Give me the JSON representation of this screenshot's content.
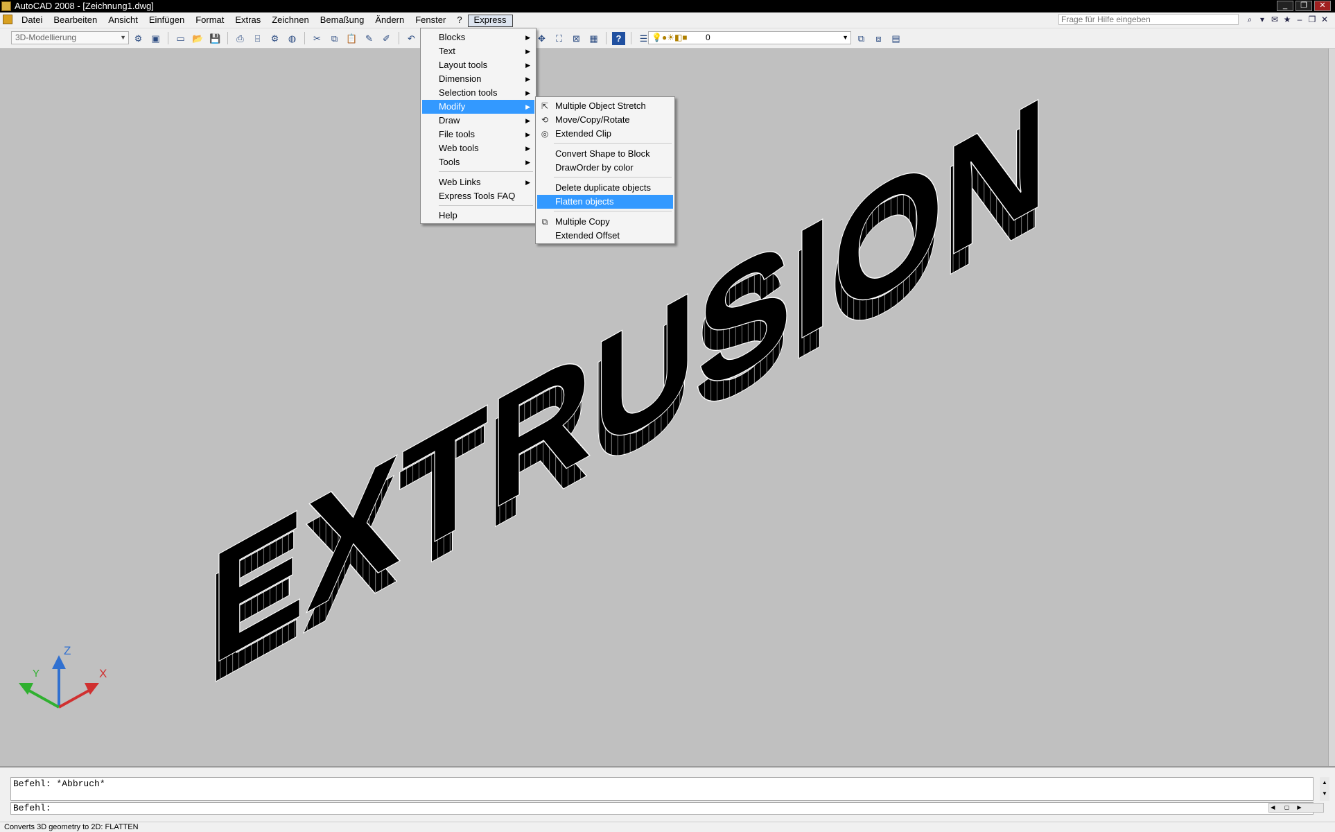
{
  "window": {
    "title": "AutoCAD 2008 - [Zeichnung1.dwg]",
    "controls": [
      "_",
      "❐",
      "✕"
    ]
  },
  "menubar": {
    "items": [
      "Datei",
      "Bearbeiten",
      "Ansicht",
      "Einfügen",
      "Format",
      "Extras",
      "Zeichnen",
      "Bemaßung",
      "Ändern",
      "Fenster",
      "?",
      "Express"
    ],
    "active": "Express",
    "help_placeholder": "Frage für Hilfe eingeben"
  },
  "toolbar": {
    "workspace": "3D-Modellierung",
    "layer_name": "0"
  },
  "express_menu": {
    "items": [
      {
        "label": "Blocks",
        "submenu": true
      },
      {
        "label": "Text",
        "submenu": true
      },
      {
        "label": "Layout tools",
        "submenu": true
      },
      {
        "label": "Dimension",
        "submenu": true
      },
      {
        "label": "Selection tools",
        "submenu": true
      },
      {
        "label": "Modify",
        "submenu": true,
        "highlighted": true
      },
      {
        "label": "Draw",
        "submenu": true
      },
      {
        "label": "File tools",
        "submenu": true
      },
      {
        "label": "Web tools",
        "submenu": true
      },
      {
        "label": "Tools",
        "submenu": true
      },
      {
        "label": "Web Links",
        "submenu": true
      },
      {
        "label": "Express Tools FAQ",
        "submenu": false
      },
      {
        "label": "Help",
        "submenu": false
      }
    ]
  },
  "modify_submenu": {
    "items": [
      {
        "label": "Multiple Object Stretch",
        "icon": "stretch-icon"
      },
      {
        "label": "Move/Copy/Rotate",
        "icon": "move-copy-rotate-icon"
      },
      {
        "label": "Extended Clip",
        "icon": "clip-icon"
      },
      {
        "label": "Convert Shape to Block"
      },
      {
        "label": "DrawOrder by color"
      },
      {
        "label": "Delete duplicate objects"
      },
      {
        "label": "Flatten objects",
        "highlighted": true
      },
      {
        "label": "Multiple Copy",
        "icon": "multiple-copy-icon"
      },
      {
        "label": "Extended Offset"
      }
    ]
  },
  "drawing": {
    "text_3d": "EXTRUSION",
    "ucs": {
      "x": "X",
      "y": "Y",
      "z": "Z"
    }
  },
  "command": {
    "history": "Befehl: *Abbruch*",
    "prompt": "Befehl:"
  },
  "status": {
    "text": "Converts 3D geometry to 2D: FLATTEN"
  },
  "colors": {
    "highlight": "#3399ff",
    "background": "#c0c0c0",
    "x_axis": "#d03030",
    "y_axis": "#30b030",
    "z_axis": "#3070d0"
  }
}
